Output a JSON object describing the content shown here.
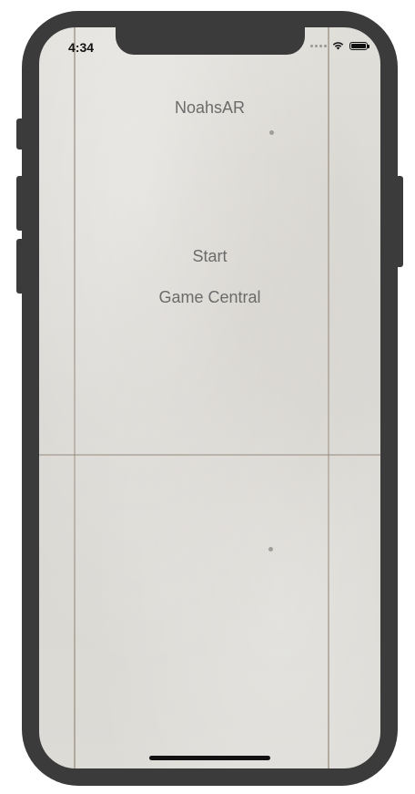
{
  "status_bar": {
    "time": "4:34",
    "wifi_icon": "wifi-icon",
    "battery_icon": "battery-icon",
    "battery_level": 1.0
  },
  "app": {
    "title": "NoahsAR"
  },
  "menu": {
    "start_label": "Start",
    "game_central_label": "Game Central"
  },
  "colors": {
    "device_frame": "#3b3b3b",
    "label_text": "#6b6b6b",
    "background_concrete": "#dcdad5"
  }
}
